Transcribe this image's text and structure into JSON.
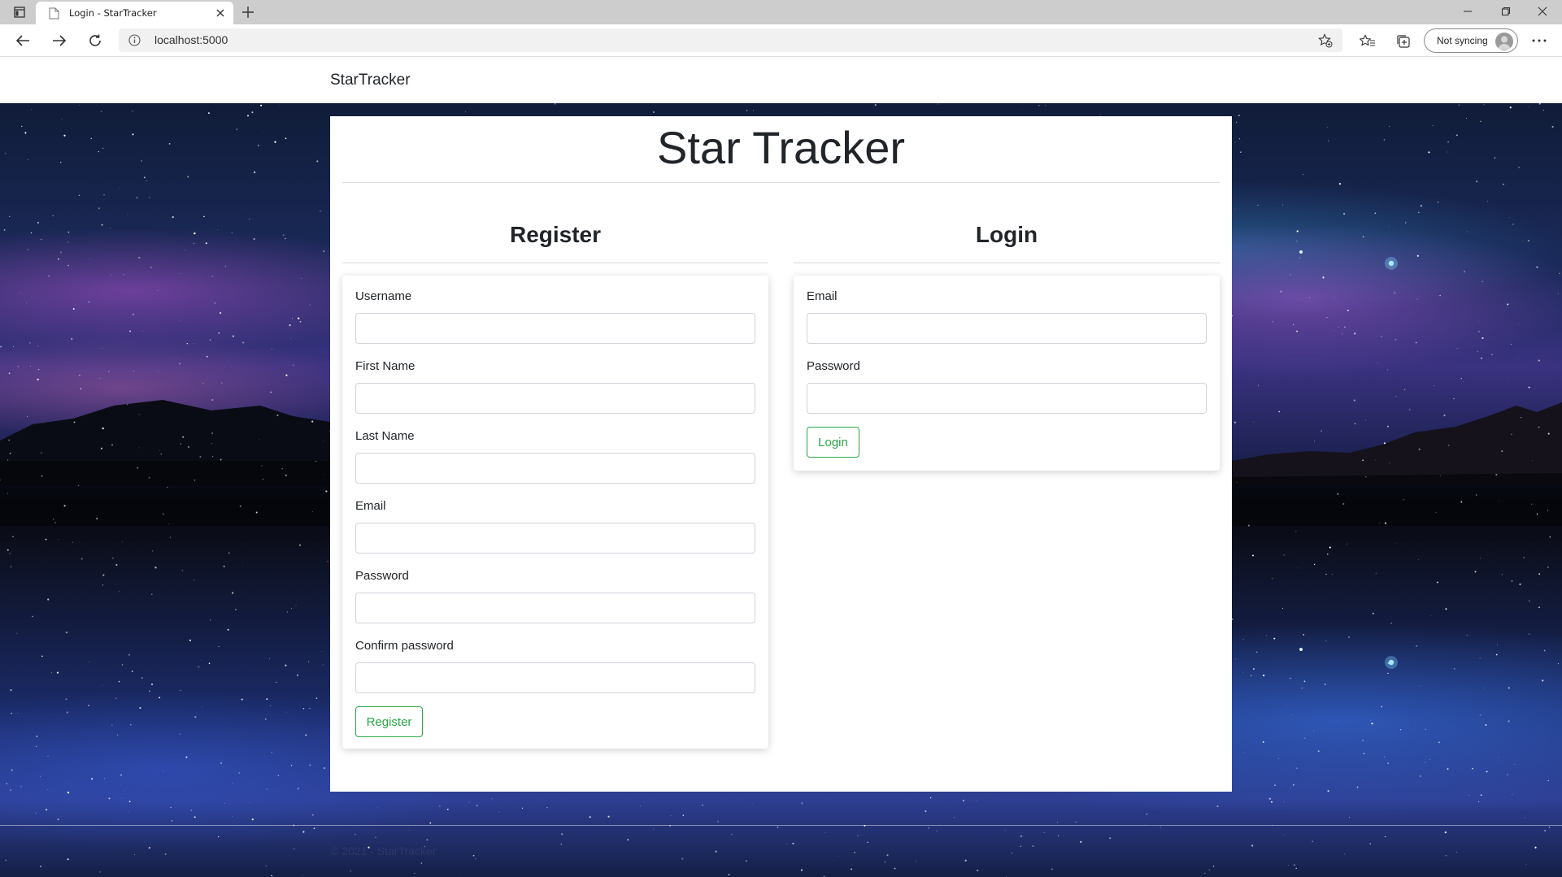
{
  "browser": {
    "tab_title": "Login - StarTracker",
    "url": "localhost:5000",
    "sync_label": "Not syncing",
    "icons": [
      "tab-actions-icon",
      "document-icon",
      "close-icon",
      "plus-icon",
      "minimize-icon",
      "restore-icon",
      "close-window-icon",
      "back-arrow-icon",
      "forward-arrow-icon",
      "refresh-icon",
      "info-icon",
      "star-add-icon",
      "favorites-icon",
      "collections-icon",
      "avatar-icon",
      "more-icon"
    ]
  },
  "nav": {
    "brand": "StarTracker"
  },
  "page": {
    "title": "Star Tracker"
  },
  "register": {
    "heading": "Register",
    "fields": [
      {
        "label": "Username",
        "value": ""
      },
      {
        "label": "First Name",
        "value": ""
      },
      {
        "label": "Last Name",
        "value": ""
      },
      {
        "label": "Email",
        "value": ""
      },
      {
        "label": "Password",
        "value": ""
      },
      {
        "label": "Confirm password",
        "value": ""
      }
    ],
    "button": "Register"
  },
  "login": {
    "heading": "Login",
    "fields": [
      {
        "label": "Email",
        "value": ""
      },
      {
        "label": "Password",
        "value": ""
      }
    ],
    "button": "Login"
  },
  "footer": {
    "text": "© 2021 - StarTracker"
  },
  "colors": {
    "accent": "#28a745",
    "text": "#212529",
    "input_border": "#ced4da"
  }
}
